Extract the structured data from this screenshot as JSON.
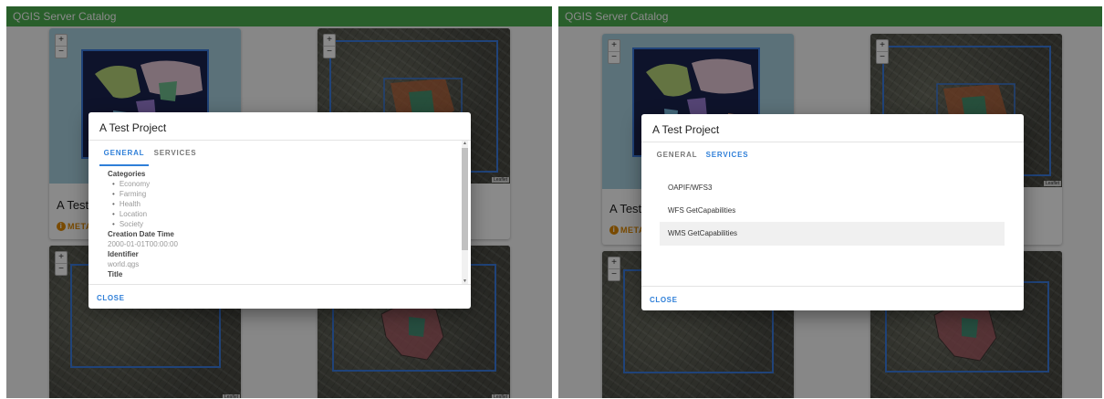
{
  "app": {
    "title": "QGIS Server Catalog"
  },
  "map": {
    "zoom_in": "+",
    "zoom_out": "−",
    "attribution": "Leaflet"
  },
  "card": {
    "title": "A Test Project",
    "metadata_label": "METADATA",
    "metadata_icon": "i"
  },
  "dialog": {
    "title": "A Test Project",
    "tabs": [
      "GENERAL",
      "SERVICES"
    ],
    "close_label": "CLOSE"
  },
  "general": {
    "categories_label": "Categories",
    "categories": [
      "Economy",
      "Farming",
      "Health",
      "Location",
      "Society"
    ],
    "creation_label": "Creation Date Time",
    "creation_value": "2000-01-01T00:00:00",
    "identifier_label": "Identifier",
    "identifier_value": "world.qgs",
    "title_label": "Title"
  },
  "services": [
    "OAPIF/WFS3",
    "WFS GetCapabilities",
    "WMS GetCapabilities"
  ],
  "colors": {
    "appbar": "#4caf50",
    "accent": "#2f7fd8",
    "bbox": "#3b7de0",
    "metadata": "#e08a00"
  }
}
